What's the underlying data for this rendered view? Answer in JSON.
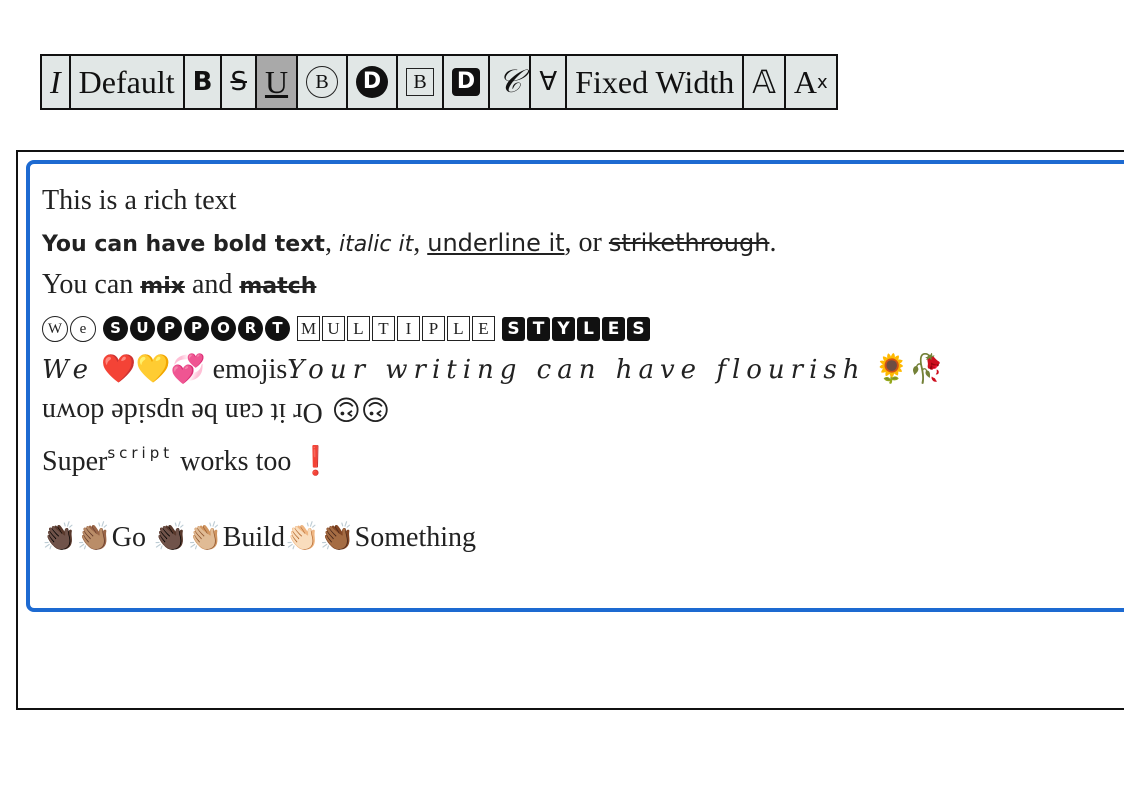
{
  "toolbar": {
    "buttons": [
      {
        "label": "I",
        "name": "italic"
      },
      {
        "label": "Default",
        "name": "default-font"
      },
      {
        "label": "B",
        "name": "bold"
      },
      {
        "label": "S",
        "name": "strikethrough"
      },
      {
        "label": "U",
        "name": "underline"
      },
      {
        "label": "B",
        "name": "circled"
      },
      {
        "label": "D",
        "name": "circled-filled"
      },
      {
        "label": "B",
        "name": "squared"
      },
      {
        "label": "D",
        "name": "squared-filled"
      },
      {
        "label": "𝒞",
        "name": "script"
      },
      {
        "label": "∀",
        "name": "upside-down"
      },
      {
        "label": "Fixed Width",
        "name": "fixed-width"
      },
      {
        "label": "𝔸",
        "name": "double-struck"
      },
      {
        "label": "A",
        "sup": "x",
        "name": "superscript"
      }
    ]
  },
  "editor": {
    "line1": "This is a rich text",
    "line2": {
      "bold": "You can have bold text",
      "sep1": ", ",
      "italic": "italic it",
      "sep2": ", ",
      "underline": "underline it",
      "sep3": ", or ",
      "strike": "strikethrough",
      "end": "."
    },
    "line3": {
      "pre": "You can ",
      "mix": "mix",
      "mid": " and ",
      "match": "match"
    },
    "line4": {
      "circle_outline": [
        "W",
        "e"
      ],
      "circle_filled": [
        "S",
        "U",
        "P",
        "P",
        "O",
        "R",
        "T"
      ],
      "square_outline": [
        "M",
        "U",
        "L",
        "T",
        "I",
        "P",
        "L",
        "E"
      ],
      "square_filled": [
        "S",
        "T",
        "Y",
        "L",
        "E",
        "S"
      ]
    },
    "line5": {
      "script1": "We",
      "hearts": "❤️💛💞",
      "emojis": " emojis",
      "script2": "Your writing can have flourish",
      "flowers": " 🌻🥀"
    },
    "line6": {
      "text": "Or it can be upside down",
      "faces": " 🙃🙃"
    },
    "line7": {
      "pre": "Super",
      "sup": "script",
      "post": " works too ",
      "excl": "❗"
    },
    "line8": {
      "clap1": "👏🏿👏🏽",
      "go": "Go ",
      "clap2": "👏🏿👏🏼",
      "build": "Build",
      "clap3": "👏🏻👏🏾",
      "something": "Something"
    }
  }
}
